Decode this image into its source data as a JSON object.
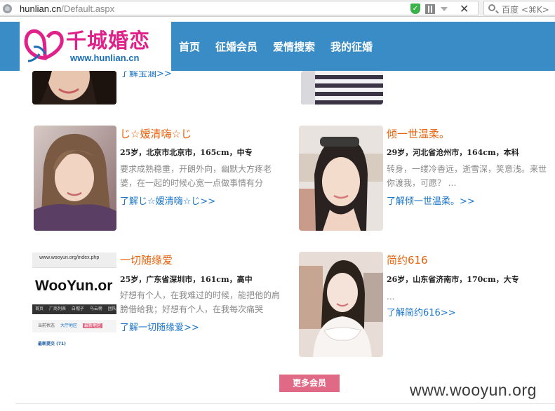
{
  "browser": {
    "url_domain": "hunlian.cn",
    "url_path": "/Default.aspx",
    "search_placeholder": "百度 <⌘K>",
    "close_glyph": "✕"
  },
  "site": {
    "logo_text": "千城婚恋",
    "logo_url": "www.hunlian.cn",
    "nav": [
      "首页",
      "征婚会员",
      "爱情搜索",
      "我的征婚"
    ]
  },
  "partial": {
    "more_link": "了解宝涵>>"
  },
  "members": [
    {
      "name": "じ☆嫒清嗨☆じ",
      "info": "25岁，北京市北京市，165cm，中专",
      "desc": "要求成熟稳重，开朗外向，幽默大方疼老婆，在一起的时候心宽一点做事情有分",
      "more": "了解じ☆嫒清嗨☆じ>>"
    },
    {
      "name": "倾一世温柔。",
      "info": "29岁，河北省沧州市，164cm，本科",
      "desc": "转身，一缕冷香远，逝雪深，笑意浅。来世你渡我，可愿？ ...",
      "more": "了解倾一世温柔。>>"
    },
    {
      "name": "一切随缘爱",
      "info": "25岁，广东省深圳市，161cm，高中",
      "desc": "好想有个人，在我难过的时候，能把他的肩膀借给我；好想有个人，在我每次痛哭",
      "more": "了解一切随缘爱>>"
    },
    {
      "name": "简约616",
      "info": "26岁，山东省济南市，170cm，大专",
      "desc": "...",
      "more": "了解简约616>>"
    }
  ],
  "wooyun_thumb": {
    "url": "www.wooyun.org/index.php",
    "brand": "WooYun.or",
    "menu": [
      "首页",
      "厂商列表",
      "白帽子",
      "乌云榜",
      "团队"
    ],
    "tabs": [
      "当前状态",
      "大厅地区",
      "最新地区"
    ],
    "latest": "最新提交 (71)"
  },
  "more_button": "更多会员",
  "watermark": "www.wooyun.org"
}
